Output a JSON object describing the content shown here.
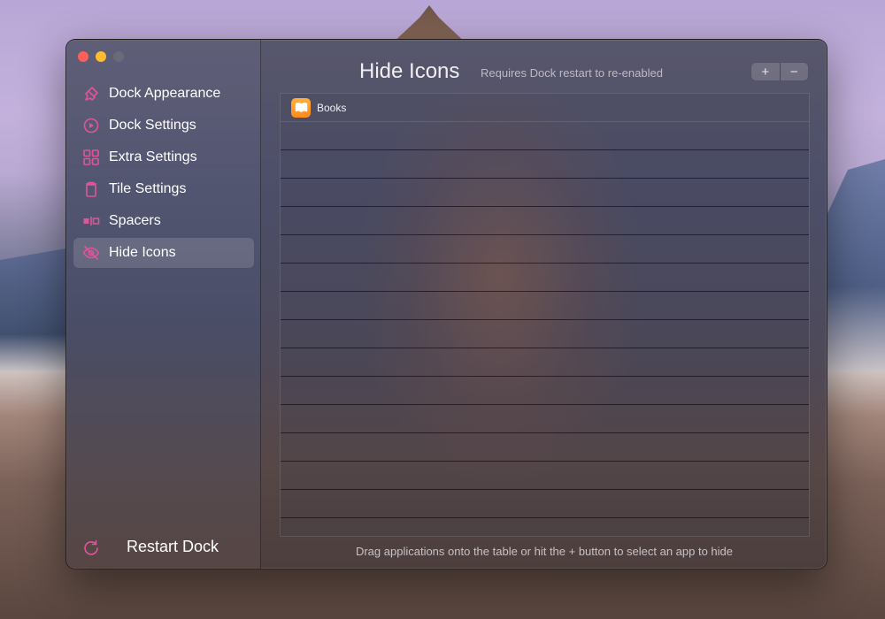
{
  "window": {
    "title": "Hide Icons",
    "subtitle": "Requires Dock restart to re-enabled"
  },
  "sidebar": {
    "items": [
      {
        "label": "Dock Appearance",
        "icon": "paintbrush-icon"
      },
      {
        "label": "Dock Settings",
        "icon": "dock-settings-icon"
      },
      {
        "label": "Extra Settings",
        "icon": "grid-icon"
      },
      {
        "label": "Tile Settings",
        "icon": "trash-icon"
      },
      {
        "label": "Spacers",
        "icon": "spacers-icon"
      },
      {
        "label": "Hide Icons",
        "icon": "eye-slash-icon",
        "active": true
      }
    ],
    "restart_label": "Restart Dock"
  },
  "toolbar": {
    "add_label": "+",
    "remove_label": "−"
  },
  "table": {
    "rows": [
      {
        "name": "Books",
        "icon": "books-icon"
      }
    ],
    "empty_row_count": 14
  },
  "footer": {
    "hint": "Drag applications onto the table or hit the + button to select an app to hide"
  },
  "colors": {
    "accent": "#e0559a",
    "close": "#fe5f57",
    "minimize": "#febc2e"
  }
}
